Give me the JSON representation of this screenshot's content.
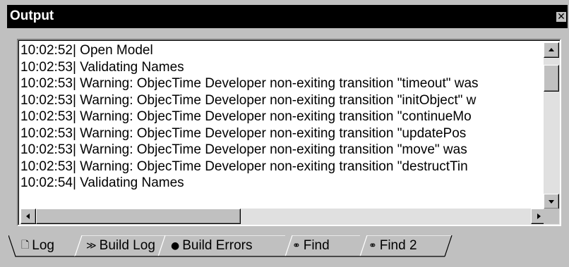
{
  "window": {
    "title": "Output",
    "close_glyph": "✕"
  },
  "log": {
    "lines": [
      "10:02:52|  Open Model",
      "10:02:53|   Validating Names",
      "10:02:53|  Warning: ObjecTime Developer non-exiting transition \"timeout\" was",
      "10:02:53|  Warning: ObjecTime Developer non-exiting transition \"initObject\" w",
      "10:02:53|  Warning: ObjecTime Developer non-exiting transition \"continueMo",
      "10:02:53|  Warning: ObjecTime Developer non-exiting transition \"updatePos",
      "10:02:53|  Warning: ObjecTime Developer non-exiting transition \"move\" was",
      "10:02:53|  Warning: ObjecTime Developer non-exiting transition \"destructTin",
      "10:02:54|   Validating Names"
    ]
  },
  "tabs": [
    {
      "label": "Log",
      "icon": "document-icon",
      "glyph": "🗋",
      "active": true
    },
    {
      "label": "Build Log",
      "icon": "build-icon",
      "glyph": "≫",
      "active": false
    },
    {
      "label": "Build Errors",
      "icon": "stop-icon",
      "glyph": "●",
      "active": false
    },
    {
      "label": "Find",
      "icon": "binoculars-icon",
      "glyph": "⚭",
      "active": false
    },
    {
      "label": "Find 2",
      "icon": "binoculars-icon",
      "glyph": "⚭",
      "active": false
    }
  ],
  "colors": {
    "titlebar_bg": "#000000",
    "titlebar_text": "#ffffff",
    "panel_bg": "#c0c0c0",
    "log_bg": "#ffffff"
  }
}
